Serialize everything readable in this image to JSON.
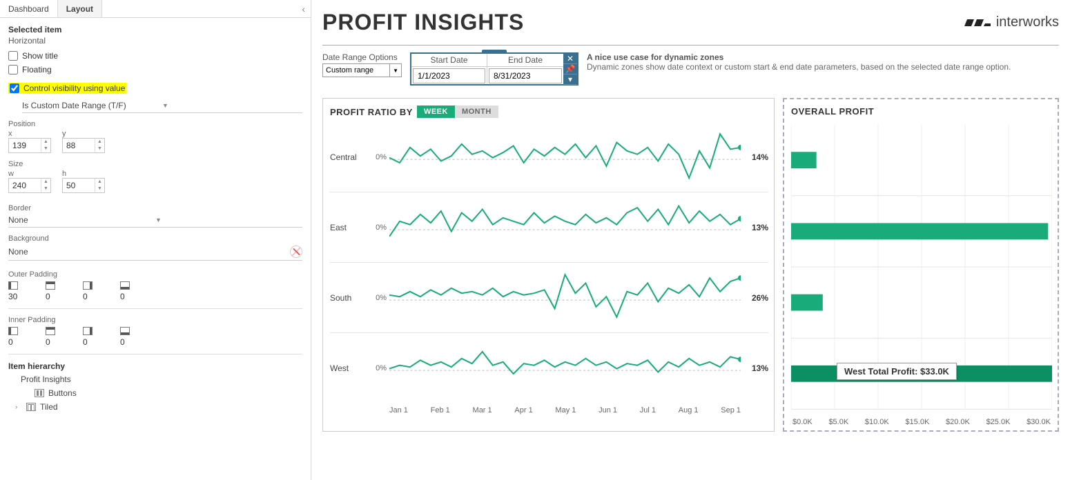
{
  "tabs": {
    "dashboard": "Dashboard",
    "layout": "Layout"
  },
  "sidebar": {
    "selected_item_hdr": "Selected item",
    "selected_item_val": "Horizontal",
    "show_title": "Show title",
    "floating": "Floating",
    "control_vis": "Control visibility using value",
    "vis_field": "Is Custom Date Range (T/F)",
    "position_hdr": "Position",
    "x_label": "x",
    "y_label": "y",
    "x_val": "139",
    "y_val": "88",
    "size_hdr": "Size",
    "w_label": "w",
    "h_label": "h",
    "w_val": "240",
    "h_val": "50",
    "border_hdr": "Border",
    "border_val": "None",
    "bg_hdr": "Background",
    "bg_val": "None",
    "outer_pad_hdr": "Outer Padding",
    "outer_pad": [
      "30",
      "0",
      "0",
      "0"
    ],
    "inner_pad_hdr": "Inner Padding",
    "inner_pad": [
      "0",
      "0",
      "0",
      "0"
    ],
    "item_hierarchy_hdr": "Item hierarchy",
    "hierarchy_root": "Profit Insights",
    "hierarchy_buttons": "Buttons",
    "hierarchy_tiled": "Tiled"
  },
  "dashboard": {
    "title": "PROFIT  INSIGHTS",
    "brand": "interworks",
    "date_range_label": "Date Range Options",
    "date_range_sel": "Custom range",
    "start_date_hdr": "Start Date",
    "end_date_hdr": "End Date",
    "start_date": "1/1/2023",
    "end_date": "8/31/2023",
    "desc_title": "A nice use case for dynamic zones",
    "desc_body": "Dynamic zones show date context or custom start & end date parameters, based on the selected date range option.",
    "left_chart_title": "PROFIT RATIO BY",
    "seg_week": "WEEK",
    "seg_month": "MONTH",
    "right_chart_title": "OVERALL PROFIT",
    "tooltip": "West Total Profit: $33.0K"
  },
  "chart_data": {
    "profit_ratio": {
      "type": "line",
      "x_ticks": [
        "Jan 1",
        "Feb 1",
        "Mar 1",
        "Apr 1",
        "May 1",
        "Jun 1",
        "Jul 1",
        "Aug 1",
        "Sep 1"
      ],
      "zero_label": "0%",
      "series": [
        {
          "region": "Central",
          "end_label": "14%",
          "values": [
            2,
            -4,
            14,
            4,
            12,
            -2,
            4,
            18,
            6,
            10,
            2,
            8,
            16,
            -4,
            12,
            4,
            14,
            6,
            18,
            2,
            16,
            -8,
            20,
            10,
            6,
            14,
            -2,
            18,
            6,
            -22,
            10,
            -10,
            30,
            12,
            14
          ]
        },
        {
          "region": "East",
          "end_label": "13%",
          "values": [
            -8,
            10,
            6,
            18,
            8,
            22,
            -2,
            20,
            10,
            24,
            6,
            14,
            10,
            6,
            20,
            8,
            16,
            10,
            6,
            18,
            8,
            14,
            6,
            20,
            26,
            10,
            24,
            6,
            28,
            8,
            22,
            10,
            18,
            6,
            13
          ]
        },
        {
          "region": "South",
          "end_label": "26%",
          "values": [
            6,
            4,
            10,
            4,
            12,
            6,
            14,
            8,
            10,
            6,
            14,
            4,
            10,
            6,
            8,
            12,
            -10,
            30,
            8,
            20,
            -8,
            4,
            -20,
            10,
            6,
            20,
            -2,
            14,
            8,
            18,
            4,
            26,
            10,
            22,
            26
          ]
        },
        {
          "region": "West",
          "end_label": "13%",
          "values": [
            2,
            6,
            4,
            12,
            6,
            10,
            4,
            14,
            8,
            22,
            6,
            10,
            -4,
            8,
            6,
            12,
            4,
            10,
            6,
            14,
            6,
            10,
            2,
            8,
            6,
            12,
            -2,
            10,
            4,
            14,
            6,
            10,
            4,
            16,
            13
          ]
        }
      ]
    },
    "overall_profit": {
      "type": "bar",
      "x_ticks": [
        "$0.0K",
        "$5.0K",
        "$10.0K",
        "$15.0K",
        "$20.0K",
        "$25.0K",
        "$30.0K"
      ],
      "xlim": [
        0,
        33
      ],
      "bars": [
        {
          "region": "Central",
          "value": 3.2
        },
        {
          "region": "East",
          "value": 32.5
        },
        {
          "region": "South",
          "value": 4.0
        },
        {
          "region": "West",
          "value": 33.0,
          "highlight": true
        }
      ]
    }
  }
}
